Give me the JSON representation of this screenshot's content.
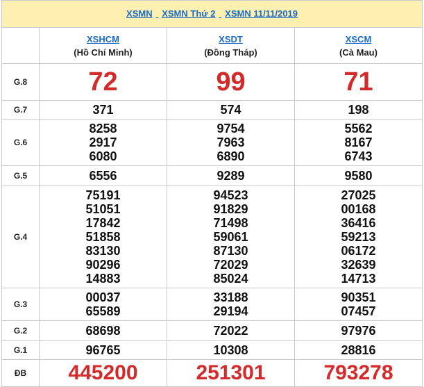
{
  "header": {
    "link1": "XSMN",
    "link2": "XSMN Thứ 2",
    "link3": "XSMN 11/11/2019"
  },
  "provinces": [
    {
      "code": "XSHCM",
      "name": "(Hồ Chí Minh)"
    },
    {
      "code": "XSDT",
      "name": "(Đồng Tháp)"
    },
    {
      "code": "XSCM",
      "name": "(Cà Mau)"
    }
  ],
  "labels": {
    "g8": "G.8",
    "g7": "G.7",
    "g6": "G.6",
    "g5": "G.5",
    "g4": "G.4",
    "g3": "G.3",
    "g2": "G.2",
    "g1": "G.1",
    "db": "ĐB"
  },
  "results": {
    "g8": [
      "72",
      "99",
      "71"
    ],
    "g7": [
      "371",
      "574",
      "198"
    ],
    "g6": [
      [
        "8258",
        "2917",
        "6080"
      ],
      [
        "9754",
        "7963",
        "6890"
      ],
      [
        "5562",
        "8167",
        "6743"
      ]
    ],
    "g5": [
      "6556",
      "9289",
      "9580"
    ],
    "g4": [
      [
        "75191",
        "51051",
        "17842",
        "51858",
        "83130",
        "90296",
        "14883"
      ],
      [
        "94523",
        "91829",
        "71498",
        "59061",
        "87130",
        "72029",
        "85024"
      ],
      [
        "27025",
        "00168",
        "36416",
        "59213",
        "06172",
        "32639",
        "14713"
      ]
    ],
    "g3": [
      [
        "00037",
        "65589"
      ],
      [
        "33188",
        "29194"
      ],
      [
        "90351",
        "07457"
      ]
    ],
    "g2": [
      "68698",
      "72022",
      "97976"
    ],
    "g1": [
      "96765",
      "10308",
      "28816"
    ],
    "db": [
      "445200",
      "251301",
      "793278"
    ]
  },
  "colors": {
    "accent_red": "#d32a2a",
    "link_blue": "#1a6cc7",
    "header_bg": "#fdf0b0"
  }
}
